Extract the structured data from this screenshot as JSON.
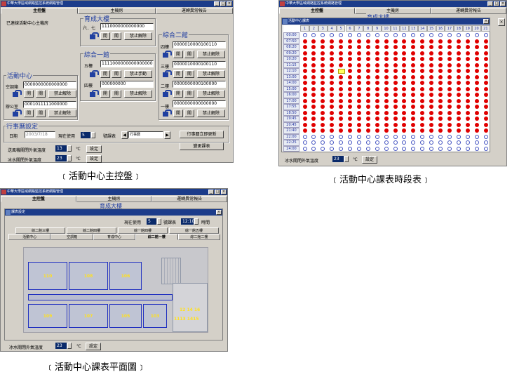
{
  "win1": {
    "title": "中華大學區域網路監控系統網路管理",
    "tabs": [
      "主控盤",
      "主機房",
      "運轉異常報告"
    ],
    "status": "已連線活動中心主機房",
    "sections": {
      "yucheng": {
        "title": "育成大樓",
        "floor_label": "六．七",
        "value": "1110000000000000",
        "open": "開",
        "close": "關",
        "disable": "禁止解除"
      },
      "zonghe1": {
        "title": "綜合一館",
        "rows": [
          {
            "label": "五樓",
            "value": "1111000000000000000",
            "open": "開",
            "close": "關",
            "disable": "禁止手動"
          },
          {
            "label": "四樓",
            "value": "000000000",
            "open": "開",
            "close": "關",
            "disable": "禁止解除"
          }
        ]
      },
      "zonghe2": {
        "title": "綜合二館",
        "rows": [
          {
            "label": "四樓",
            "value": "0000010000100110",
            "open": "開",
            "close": "關",
            "disable": "禁止解除"
          },
          {
            "label": "三樓",
            "value": "0000010000100110",
            "open": "開",
            "close": "關",
            "disable": "禁止解除"
          },
          {
            "label": "二樓",
            "value": "0000000000100000",
            "open": "開",
            "close": "關",
            "disable": "禁止解除"
          },
          {
            "label": "一樓",
            "value": "0000000000000000",
            "open": "開",
            "close": "關",
            "disable": "禁止解除"
          }
        ]
      },
      "activity": {
        "title": "活動中心",
        "rows": [
          {
            "label": "空調箱",
            "value": "0000000000000000",
            "open": "開",
            "close": "關",
            "disable": "禁止解除"
          },
          {
            "label": "辦公室",
            "value": "0001011111000000",
            "open": "開",
            "close": "關",
            "disable": "禁止解除"
          }
        ]
      }
    },
    "schedule": {
      "title": "行事曆設定",
      "date_label": "日期",
      "date_value": "2003/7/18",
      "current_label": "現在使用",
      "current_value": "5",
      "course_label": "號課表",
      "calendar_label": "行事曆",
      "refresh_button": "行事曆立即更新",
      "change_button": "變更課表",
      "fan_label": "送風機關閉外氣溫度",
      "fan_value": "13",
      "unit": "℃",
      "set_button": "設定",
      "chiller_label": "冰水關閉外氣溫度",
      "chiller_value": "23"
    },
    "caption": "﹝活動中心主控盤﹞"
  },
  "win2": {
    "title": "中華大學區域網路監控系統網路管理",
    "tabs": [
      "主控盤",
      "主機房",
      "運轉異常報告"
    ],
    "behind_title": "育成大樓",
    "dialog_title": "活動中心課表",
    "columns": [
      "1",
      "2",
      "3",
      "4",
      "5",
      "6",
      "7",
      "8",
      "9",
      "10",
      "11",
      "12",
      "13",
      "14",
      "15",
      "16",
      "17",
      "18",
      "19",
      "20",
      "21"
    ],
    "times": [
      "00:00",
      "07:50",
      "08:20",
      "09:20",
      "10:20",
      "11:15",
      "12:10",
      "13:00",
      "14:00",
      "15:00",
      "16:00",
      "17:00",
      "17:55",
      "18:50",
      "19:45",
      "20:45",
      "21:40",
      "22:00",
      "22:25",
      "24:00"
    ],
    "active_rows": [
      1,
      16
    ],
    "highlight": {
      "row": 6,
      "col": 4
    },
    "chiller_label": "冰水關閉外氣溫度",
    "chiller_value": "23",
    "unit": "℃",
    "set_button": "設定",
    "caption": "﹝活動中心課表時段表﹞"
  },
  "win3": {
    "title": "中華大學區域網路監控系統網路管理",
    "tabs": [
      "主控盤",
      "主機房",
      "運轉異常報告"
    ],
    "dialog_title": "課表設定",
    "current_label": "現在使用",
    "current_value": "5",
    "course_label": "號課表",
    "time_value": "12:10",
    "time_label": "時間",
    "behind_title": "育成大樓",
    "tabs_row1": [
      "綜二館三樓",
      "綜二館四樓",
      "綜一館四樓",
      "綜一館五樓"
    ],
    "tabs_row2": [
      "活動中心",
      "空調箱",
      "育成中心",
      "綜二館一樓",
      "綜二館二樓"
    ],
    "rooms_top": [
      "110",
      "108",
      "106"
    ],
    "rooms_bottom": [
      "109",
      "107",
      "105",
      "103"
    ],
    "rooms_right": [
      "12 14 16",
      "1113 1415"
    ],
    "chiller_label": "冰水關閉外氣溫度",
    "chiller_value": "23",
    "unit": "℃",
    "set_button": "設定",
    "caption": "﹝活動中心課表平面圖﹞"
  }
}
